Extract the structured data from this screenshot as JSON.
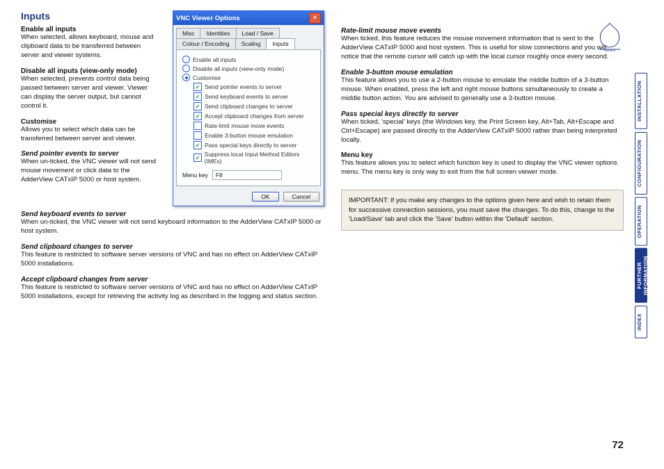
{
  "page_number": "72",
  "brand": "ADDER",
  "title": "Inputs",
  "sidebar": [
    {
      "label": "INSTALLATION",
      "active": false
    },
    {
      "label": "CONFIGURATION",
      "active": false
    },
    {
      "label": "OPERATION",
      "active": false
    },
    {
      "label": "FURTHER\nINFORMATION",
      "active": true
    },
    {
      "label": "INDEX",
      "active": false
    }
  ],
  "dialog": {
    "title": "VNC Viewer Options",
    "tabs_row1": [
      "Misc",
      "Identities",
      "Load / Save"
    ],
    "tabs_row2": [
      "Colour / Encoding",
      "Scaling",
      "Inputs"
    ],
    "active_tab": "Inputs",
    "radios": {
      "r1": "Enable all inputs",
      "r2": "Disable all inputs (view-only mode)",
      "r3": "Customise"
    },
    "checks": {
      "c1": {
        "label": "Send pointer events to server",
        "on": true
      },
      "c2": {
        "label": "Send keyboard events to server",
        "on": true
      },
      "c3": {
        "label": "Send clipboard changes to server",
        "on": true
      },
      "c4": {
        "label": "Accept clipboard changes from server",
        "on": true
      },
      "c5": {
        "label": "Rate-limit mouse move events",
        "on": false
      },
      "c6": {
        "label": "Enable 3-button mouse emulation",
        "on": false
      },
      "c7": {
        "label": "Pass special keys directly to server",
        "on": true
      },
      "c8": {
        "label": "Suppress local Input Method Editors (IMEs)",
        "on": true
      }
    },
    "menu_label": "Menu key",
    "menu_value": "F8",
    "ok": "OK",
    "cancel": "Cancel"
  },
  "left": {
    "s1": {
      "title": "Enable all inputs",
      "body": "When selected, allows keyboard, mouse and clipboard data to be transferred between server and viewer systems."
    },
    "s2": {
      "title": "Disable all inputs (view-only mode)",
      "body": "When selected, prevents control data being passed between server and viewer. Viewer can display the server output, but cannot control it."
    },
    "s3": {
      "title": "Customise",
      "body": "Allows you to select which data can be transferred between server and viewer."
    },
    "s4": {
      "title": "Send pointer events to server",
      "body": "When un-ticked, the VNC viewer will not send mouse movement or click data to the AdderView CATxIP 5000 or host system."
    },
    "s5": {
      "title": "Send keyboard events to server",
      "body": "When un-ticked, the VNC viewer will not send keyboard information to the AdderView CATxIP 5000 or host system."
    },
    "s6": {
      "title": "Send clipboard changes to server",
      "body": "This feature is restricted to software server versions of VNC and has no effect on AdderView CATxIP 5000 installations."
    },
    "s7": {
      "title": "Accept clipboard changes from server",
      "body": "This feature is restricted to software server versions of VNC and has no effect on AdderView CATxIP 5000 installations, except for retrieving the activity log as described in the logging and status section."
    }
  },
  "right": {
    "s1": {
      "title": "Rate-limit mouse move events",
      "body": "When ticked, this feature reduces the mouse movement information that is sent to the AdderView CATxIP 5000 and host system. This is useful for slow connections and you will notice that the remote cursor will catch up with the local cursor roughly once every second."
    },
    "s2": {
      "title": "Enable 3-button mouse emulation",
      "body": "This feature allows you to use a 2-button mouse to emulate the middle button of a 3-button mouse. When enabled, press the left and right mouse buttons simultaneously to create a middle button action. You are advised to generally use a 3-button mouse."
    },
    "s3": {
      "title": "Pass special keys directly to server",
      "body": "When ticked, 'special' keys (the Windows key, the Print Screen key, Alt+Tab, Alt+Escape and Ctrl+Escape) are passed directly to the AdderView CATxIP 5000 rather than being interpreted locally."
    },
    "s4": {
      "title": "Menu key",
      "body": "This feature allows you to select which function key is used to display the VNC viewer options menu. The menu key is only way to exit from the full screen viewer mode."
    }
  },
  "important": "IMPORTANT: If you make any changes to the options given here and wish to retain them for successive connection sessions, you must save the changes. To do this, change to the 'Load/Save' tab and click the 'Save' button within the 'Default' section."
}
